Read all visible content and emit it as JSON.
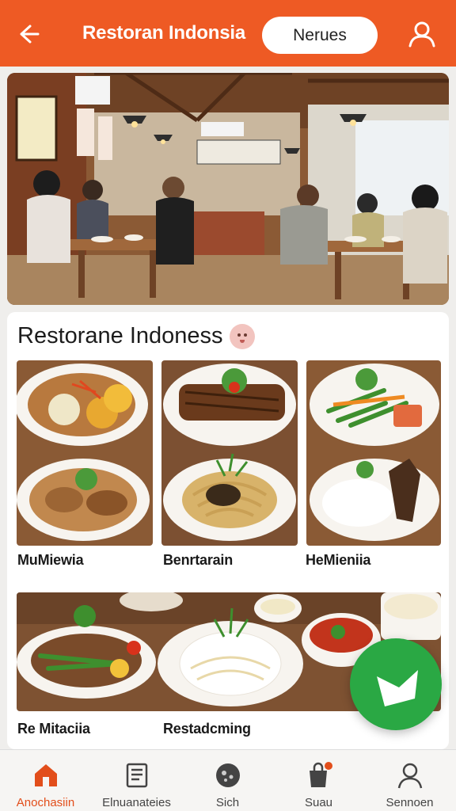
{
  "header": {
    "title": "Restoran Indonsia",
    "menu_button": "Nerues"
  },
  "card": {
    "title": "Restorane Indoness"
  },
  "dishes": [
    {
      "caption": "MuMiewia"
    },
    {
      "caption": "Benrtarain"
    },
    {
      "caption": "HeMieniia"
    },
    {
      "caption": "Re Mitaciia"
    },
    {
      "caption": "Restadcming"
    }
  ],
  "nav": {
    "items": [
      {
        "label": "Anochasiin",
        "icon": "home-icon",
        "active": true
      },
      {
        "label": "Elnuanateies",
        "icon": "menu-book-icon",
        "active": false
      },
      {
        "label": "Sich",
        "icon": "search-icon",
        "active": false
      },
      {
        "label": "Suau",
        "icon": "shopping-bag-icon",
        "active": false
      },
      {
        "label": "Sennoen",
        "icon": "profile-icon",
        "active": false
      }
    ]
  },
  "colors": {
    "header": "#ee5a24",
    "fab": "#2aa844",
    "active_nav": "#e24e1b"
  }
}
